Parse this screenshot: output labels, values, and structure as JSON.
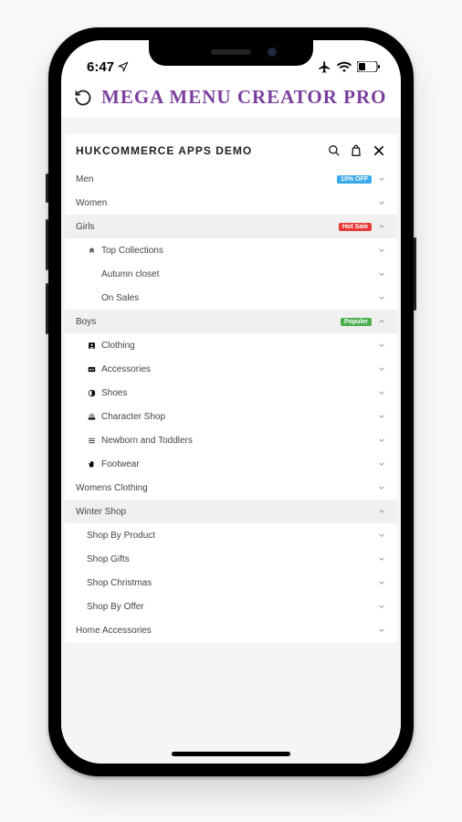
{
  "statusbar": {
    "time": "6:47"
  },
  "appbar": {
    "title": "MEGA MENU CREATOR PRO"
  },
  "site_header": {
    "title": "HUKCOMMERCE APPS DEMO"
  },
  "menu": {
    "men": {
      "label": "Men",
      "badge": "10% OFF"
    },
    "women": {
      "label": "Women"
    },
    "girls": {
      "label": "Girls",
      "badge": "Hot Sale",
      "children": {
        "top_collections": "Top Collections",
        "autumn_closet": "Autumn closet",
        "on_sales": "On Sales"
      }
    },
    "boys": {
      "label": "Boys",
      "badge": "Populer",
      "children": {
        "clothing": "Clothing",
        "accessories": "Accessories",
        "shoes": "Shoes",
        "character_shop": "Character Shop",
        "newborn_toddlers": "Newborn and Toddlers",
        "footwear": "Footwear"
      }
    },
    "womens_clothing": {
      "label": "Womens Clothing"
    },
    "winter_shop": {
      "label": "Winter Shop",
      "children": {
        "shop_by_product": "Shop By Product",
        "shop_gifts": "Shop Gifts",
        "shop_christmas": "Shop Christmas",
        "shop_by_offer": "Shop By Offer"
      }
    },
    "home_accessories": {
      "label": "Home Accessories"
    }
  }
}
